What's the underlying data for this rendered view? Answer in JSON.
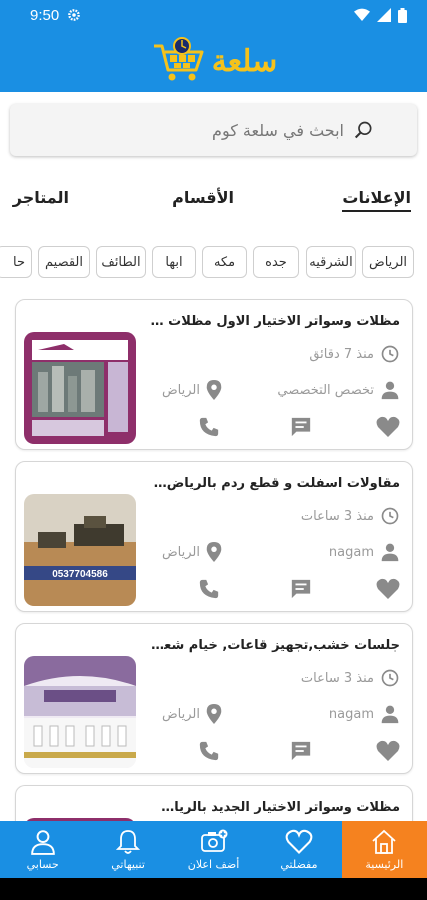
{
  "status": {
    "time": "9:50"
  },
  "header": {
    "logo_text": "سلعة"
  },
  "search": {
    "placeholder": "ابحث في سلعة كوم"
  },
  "tabs": [
    {
      "label": "الإعلانات",
      "active": true
    },
    {
      "label": "الأقسام",
      "active": false
    },
    {
      "label": "المتاجر",
      "active": false
    }
  ],
  "cities": [
    "الرياض",
    "الشرقيه",
    "جده",
    "مكه",
    "ابها",
    "الطائف",
    "القصيم",
    "حا"
  ],
  "ads": [
    {
      "title": "مظلات وسواتر الاختيار الاول مظلات مواق...",
      "time": "منذ 7 دقائق",
      "user": "تخصص التخصصي",
      "city": "الرياض",
      "thumb_color": "#8e2f6a"
    },
    {
      "title": "مقاولات اسفلت و قطع ردم بالرياض 086 ...7",
      "time": "منذ 3 ساعات",
      "user": "nagam",
      "city": "الرياض",
      "thumb_caption": "0537704586",
      "thumb_color": "#b88a55"
    },
    {
      "title": "جلسات خشب,تجهيز قاعات, خيام شعبية ,خ...",
      "time": "منذ 3 ساعات",
      "user": "nagam",
      "city": "الرياض",
      "thumb_color": "#8a6b9e"
    },
    {
      "title": "مظلات وسواتر الاختيار الجديد بالرياض - با...",
      "thumb_color": "#8e2f6a"
    }
  ],
  "nav": [
    {
      "label": "حسابي",
      "icon": "person-icon"
    },
    {
      "label": "تنبيهاتي",
      "icon": "bell-icon"
    },
    {
      "label": "أضف اعلان",
      "icon": "camera-add-icon"
    },
    {
      "label": "مفضلتي",
      "icon": "heart-icon"
    },
    {
      "label": "الرئيسية",
      "icon": "home-icon",
      "active": true
    }
  ],
  "colors": {
    "primary": "#1a8fe3",
    "accent": "#f5821f",
    "logo": "#f5c21b",
    "icon_gray": "#8a8a8a"
  }
}
